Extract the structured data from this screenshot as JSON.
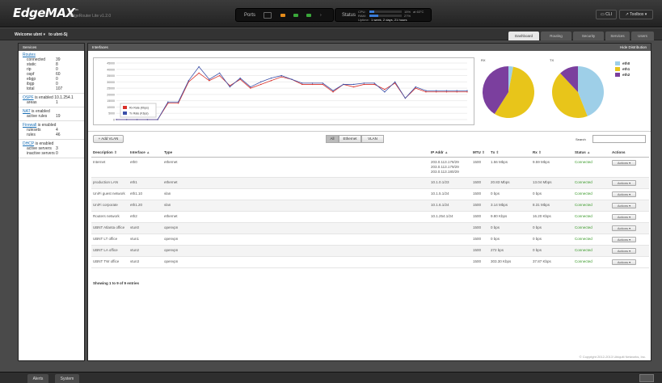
{
  "header": {
    "logo": "EdgeMAX",
    "version": "EdgeRouter Lite v1.2.0",
    "ports_label": "Ports",
    "status_label": "Status",
    "cpu_label": "CPU:",
    "cpu_value": "15%",
    "temp": "at 63°C",
    "ram_label": "RAM:",
    "ram_value": "27%",
    "uptime_label": "Uptime:",
    "uptime_value": "1 week, 2 days, 21 hours",
    "cli_label": "CLI",
    "toolbox_label": "Toolbox",
    "cpu_pct": 15,
    "ram_pct": 27
  },
  "subbar": {
    "welcome": "Welcome ubnt",
    "device": "to ubnt-Sj",
    "tabs": [
      "Dashboard",
      "Routing",
      "Security",
      "Services",
      "Users"
    ]
  },
  "sidebar": {
    "title": "Services",
    "routes": {
      "link": "Routes",
      "rows": [
        [
          "connected",
          "39"
        ],
        [
          "static",
          "8"
        ],
        [
          "rip",
          "0"
        ],
        [
          "ospf",
          "60"
        ],
        [
          "ebgp",
          "0"
        ],
        [
          "ibgp",
          "0"
        ],
        [
          "total",
          "107"
        ]
      ]
    },
    "ospf": {
      "link": "OSPF",
      "text": "is enabled",
      "ip": "10.1.254.1",
      "rows": [
        [
          "areas",
          "1"
        ]
      ]
    },
    "nat": {
      "link": "NAT",
      "text": "is enabled",
      "rows": [
        [
          "active rules",
          "19"
        ]
      ]
    },
    "firewall": {
      "link": "Firewall",
      "text": "is enabled",
      "rows": [
        [
          "rulesets",
          "4"
        ],
        [
          "rules",
          "46"
        ]
      ]
    },
    "dhcp": {
      "link": "DHCP",
      "text": "is enabled",
      "rows": [
        [
          "active servers",
          "3"
        ],
        [
          "inactive servers",
          "0"
        ]
      ]
    }
  },
  "interfaces": {
    "title": "Interfaces",
    "hide": "Hide Distribution",
    "rx": "RX",
    "tx": "TX",
    "legend": [
      "eth0",
      "eth1",
      "eth2"
    ],
    "rx_legend": "Rx Rate (Kbps)",
    "tx_legend": "Tx Rate (Kbps)",
    "colors": {
      "eth0": "#9ecfe8",
      "eth1": "#e8c51a",
      "eth2": "#7b3f9e",
      "rx": "#d9302a",
      "tx": "#3b4fa8"
    }
  },
  "chart_data": [
    {
      "type": "line",
      "ylim": [
        0,
        45000
      ],
      "yticks": [
        "45000",
        "40000",
        "35000",
        "30000",
        "25000",
        "20000",
        "15000",
        "10000",
        "5000",
        "0"
      ],
      "series": [
        {
          "name": "Rx Rate (Kbps)",
          "values": [
            0,
            0,
            0,
            0,
            0,
            13000,
            13000,
            30000,
            37000,
            31000,
            35000,
            27000,
            32000,
            25000,
            28000,
            31000,
            34000,
            32000,
            28000,
            28000,
            28000,
            22000,
            28000,
            26000,
            28000,
            28000,
            24000,
            29000,
            17000,
            25000,
            22000,
            22000,
            22000,
            22000,
            22000
          ]
        },
        {
          "name": "Tx Rate (Kbps)",
          "values": [
            0,
            0,
            0,
            0,
            0,
            14000,
            14000,
            31000,
            42000,
            32000,
            37000,
            26000,
            33000,
            26000,
            30000,
            33000,
            35000,
            32000,
            29000,
            29000,
            29000,
            23000,
            28000,
            28000,
            29000,
            29000,
            22000,
            30000,
            17000,
            26000,
            23000,
            23000,
            23000,
            23000,
            23000
          ]
        }
      ]
    },
    {
      "type": "pie",
      "title": "RX",
      "categories": [
        "eth0",
        "eth1",
        "eth2"
      ],
      "values": [
        3,
        56,
        41
      ]
    },
    {
      "type": "pie",
      "title": "TX",
      "categories": [
        "eth0",
        "eth1",
        "eth2"
      ],
      "values": [
        44,
        44,
        12
      ]
    }
  ],
  "toolbar": {
    "add": "+ Add VLAN",
    "filters": [
      "All",
      "Ethernet",
      "VLAN"
    ],
    "search": "Search"
  },
  "table": {
    "headers": [
      "Description",
      "Interface",
      "Type",
      "IP Addr",
      "MTU",
      "Tx",
      "Rx",
      "Status",
      "Actions"
    ],
    "rows": [
      {
        "desc": "Internet",
        "iface": "eth0",
        "type": "ethernet",
        "ip": "203.0.113.178/29\n203.0.113.179/29\n203.0.113.180/29",
        "mtu": "1500",
        "tx": "1.56 Mbps",
        "rx": "9.59 Mbps",
        "status": "Connected",
        "action": "Actions"
      },
      {
        "desc": "production LAN",
        "iface": "eth1",
        "type": "ethernet",
        "ip": "10.1.0.1/23",
        "mtu": "1500",
        "tx": "20.83 Mbps",
        "rx": "13.04 Mbps",
        "status": "Connected",
        "action": "Actions"
      },
      {
        "desc": "UniFi guest network",
        "iface": "eth1.10",
        "type": "vlan",
        "ip": "10.1.5.1/24",
        "mtu": "1500",
        "tx": "0 bps",
        "rx": "0 bps",
        "status": "Connected",
        "action": "Actions"
      },
      {
        "desc": "UniFi corporate",
        "iface": "eth1.20",
        "type": "vlan",
        "ip": "10.1.6.1/24",
        "mtu": "1500",
        "tx": "3.14 Mbps",
        "rx": "8.31 Mbps",
        "status": "Connected",
        "action": "Actions"
      },
      {
        "desc": "Routers network",
        "iface": "eth2",
        "type": "ethernet",
        "ip": "10.1.254.1/24",
        "mtu": "1500",
        "tx": "9.80 Kbps",
        "rx": "16.20 Kbps",
        "status": "Connected",
        "action": "Actions"
      },
      {
        "desc": "UBNT Atlanta office",
        "iface": "vtun0",
        "type": "openvpn",
        "ip": "",
        "mtu": "1500",
        "tx": "0 bps",
        "rx": "0 bps",
        "status": "Connected",
        "action": "Actions"
      },
      {
        "desc": "UBNT LT office",
        "iface": "vtun1",
        "type": "openvpn",
        "ip": "",
        "mtu": "1500",
        "tx": "0 bps",
        "rx": "0 bps",
        "status": "Connected",
        "action": "Actions"
      },
      {
        "desc": "UBNT LA office",
        "iface": "vtun2",
        "type": "openvpn",
        "ip": "",
        "mtu": "1500",
        "tx": "272 bps",
        "rx": "0 bps",
        "status": "Connected",
        "action": "Actions"
      },
      {
        "desc": "UBNT TW office",
        "iface": "vtun3",
        "type": "openvpn",
        "ip": "",
        "mtu": "1500",
        "tx": "303.30 Kbps",
        "rx": "37.87 Kbps",
        "status": "Connected",
        "action": "Actions"
      }
    ],
    "footer": "Showing 1 to 9 of 9 entries"
  },
  "copyright": "© Copyright 2012-2013 Ubiquiti Networks, Inc.",
  "bottom": {
    "tabs": [
      "Alerts",
      "System"
    ]
  }
}
